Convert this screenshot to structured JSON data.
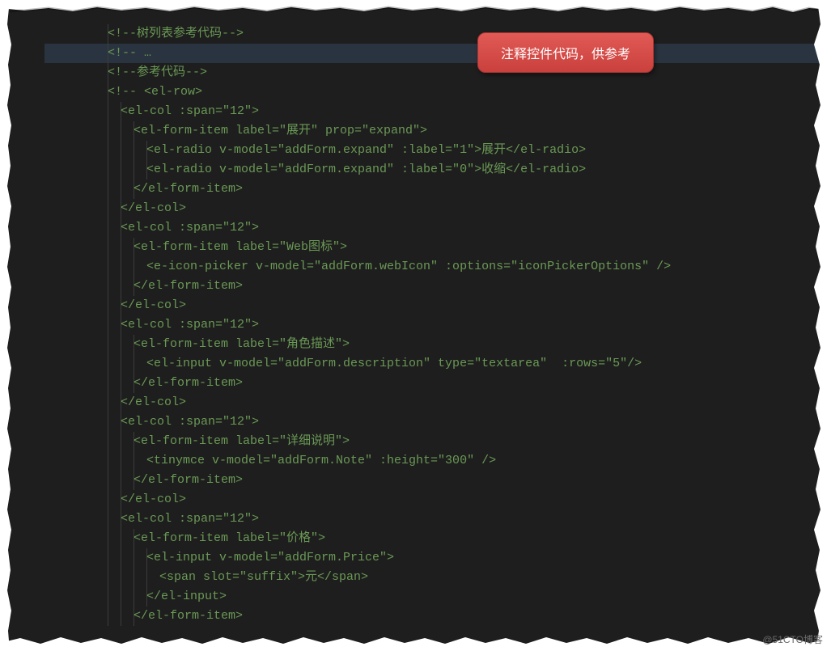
{
  "callout": {
    "text": "注释控件代码，供参考"
  },
  "watermark": "@51CTO博客",
  "code": {
    "lines": [
      {
        "indent": 0,
        "s": "<!--树列表参考代码-->"
      },
      {
        "indent": 0,
        "s": "<!-- …"
      },
      {
        "indent": 0,
        "s": "<!--参考代码-->"
      },
      {
        "indent": 0,
        "s": "<!-- <el-row>"
      },
      {
        "indent": 1,
        "s": "<el-col :span=\"12\">"
      },
      {
        "indent": 2,
        "s": "<el-form-item label=\"展开\" prop=\"expand\">"
      },
      {
        "indent": 3,
        "s": "<el-radio v-model=\"addForm.expand\" :label=\"1\">展开</el-radio>"
      },
      {
        "indent": 3,
        "s": "<el-radio v-model=\"addForm.expand\" :label=\"0\">收缩</el-radio>"
      },
      {
        "indent": 2,
        "s": "</el-form-item>"
      },
      {
        "indent": 1,
        "s": "</el-col>"
      },
      {
        "indent": 1,
        "s": "<el-col :span=\"12\">"
      },
      {
        "indent": 2,
        "s": "<el-form-item label=\"Web图标\">"
      },
      {
        "indent": 3,
        "s": "<e-icon-picker v-model=\"addForm.webIcon\" :options=\"iconPickerOptions\" />"
      },
      {
        "indent": 2,
        "s": "</el-form-item>"
      },
      {
        "indent": 1,
        "s": "</el-col>"
      },
      {
        "indent": 1,
        "s": "<el-col :span=\"12\">"
      },
      {
        "indent": 2,
        "s": "<el-form-item label=\"角色描述\">"
      },
      {
        "indent": 3,
        "s": "<el-input v-model=\"addForm.description\" type=\"textarea\"  :rows=\"5\"/>"
      },
      {
        "indent": 2,
        "s": "</el-form-item>"
      },
      {
        "indent": 1,
        "s": "</el-col>"
      },
      {
        "indent": 1,
        "s": "<el-col :span=\"12\">"
      },
      {
        "indent": 2,
        "s": "<el-form-item label=\"详细说明\">"
      },
      {
        "indent": 3,
        "s": "<tinymce v-model=\"addForm.Note\" :height=\"300\" />"
      },
      {
        "indent": 2,
        "s": "</el-form-item>"
      },
      {
        "indent": 1,
        "s": "</el-col>"
      },
      {
        "indent": 1,
        "s": "<el-col :span=\"12\">"
      },
      {
        "indent": 2,
        "s": "<el-form-item label=\"价格\">"
      },
      {
        "indent": 3,
        "s": "<el-input v-model=\"addForm.Price\">"
      },
      {
        "indent": 4,
        "s": "<span slot=\"suffix\">元</span>"
      },
      {
        "indent": 3,
        "s": "</el-input>"
      },
      {
        "indent": 2,
        "s": "</el-form-item>"
      }
    ]
  }
}
